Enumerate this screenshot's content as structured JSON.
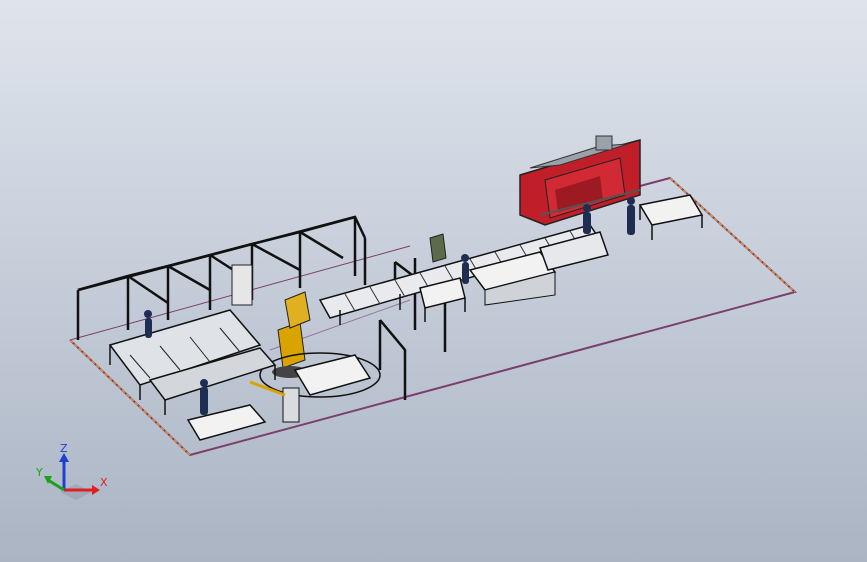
{
  "triad": {
    "x_label": "X",
    "y_label": "Y",
    "z_label": "Z"
  },
  "colors": {
    "background_top": "#dfe4ec",
    "background_bottom": "#aab4c3",
    "floor_outline": "#7a3f6a",
    "floor_edge_accent": "#e0953a",
    "frame": "#111111",
    "press_brake_red": "#c01f2a",
    "press_brake_grey": "#9aa1aa",
    "table_white": "#f2f2f2",
    "robot_yellow": "#d9a400",
    "worker_blue": "#1d2e52",
    "axis_x": "#e02020",
    "axis_y": "#1aa31a",
    "axis_z": "#2040d0"
  },
  "icons": {
    "triad": "xyz-orientation-triad-icon"
  }
}
